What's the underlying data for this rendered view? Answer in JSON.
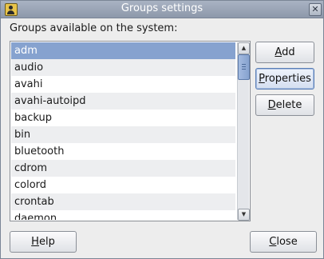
{
  "window": {
    "title": "Groups settings",
    "close_glyph": "✕"
  },
  "label": "Groups available on the system:",
  "groups": {
    "items": [
      "adm",
      "audio",
      "avahi",
      "avahi-autoipd",
      "backup",
      "bin",
      "bluetooth",
      "cdrom",
      "colord",
      "crontab",
      "daemon"
    ],
    "selected": "adm"
  },
  "buttons": {
    "add": {
      "mnemonic": "A",
      "rest": "dd"
    },
    "properties": {
      "mnemonic": "P",
      "rest": "roperties"
    },
    "delete": {
      "mnemonic": "D",
      "rest": "elete"
    },
    "help": {
      "mnemonic": "H",
      "rest": "elp"
    },
    "close": {
      "mnemonic": "C",
      "rest": "lose"
    }
  },
  "icons": {
    "app": "user-group-icon",
    "scroll_up": "▲",
    "scroll_down": "▼"
  },
  "colors": {
    "selection": "#86a2cf",
    "titlebar": "#97a1b3"
  }
}
